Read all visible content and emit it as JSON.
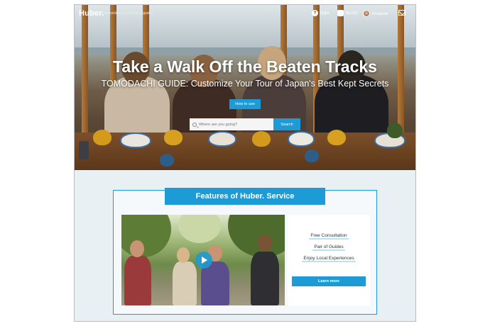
{
  "nav": {
    "logo": "Huber.",
    "tagline": "Connecting you with local guides",
    "qa_label": "Q&A",
    "blog_label": "BLOG",
    "user_label": "Kiwako▾"
  },
  "hero": {
    "title": "Take a Walk Off the Beaten Tracks",
    "subtitle": "TOMODACHI GUIDE: Customize Your Tour of Japan's Best Kept Secrets",
    "how_to_use_label": "How to use",
    "search_placeholder": "Where are you going?",
    "search_button_label": "Search"
  },
  "features": {
    "title": "Features of Huber. Service",
    "items": [
      "Free Consultation",
      "Pair of Guides",
      "Enjoy Local Experiences"
    ],
    "learn_more_label": "Learn more"
  },
  "colors": {
    "accent": "#1c9bd6",
    "section_bg": "#e9f0f4"
  },
  "icons": {
    "qa": "question-icon",
    "blog": "pencil-icon",
    "avatar": "user-avatar",
    "mail": "mail-icon",
    "search": "search-icon",
    "play": "play-icon"
  }
}
